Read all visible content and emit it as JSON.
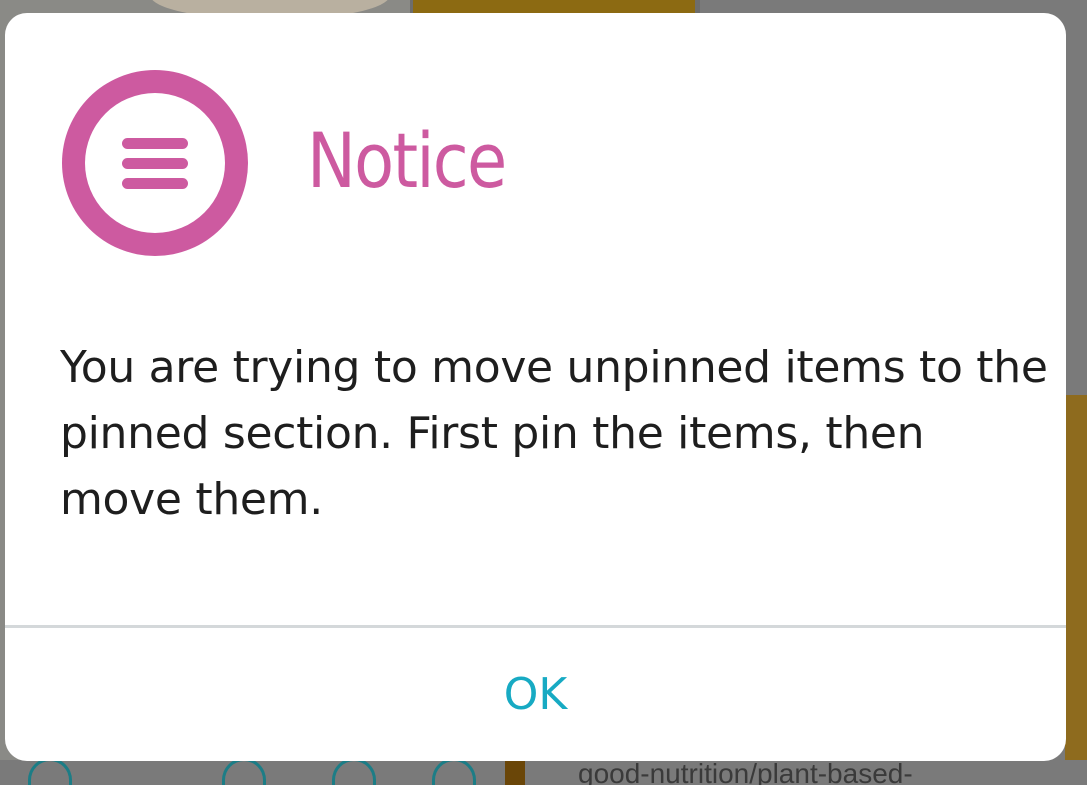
{
  "dialog": {
    "icon": "menu-icon",
    "title": "Notice",
    "message": "You are trying to move unpinned items to the pinned section. First pin the items, then move them.",
    "ok_label": "OK"
  },
  "background": {
    "url_fragment": "good-nutrition/plant-based-"
  },
  "colors": {
    "accent": "#cd5aa0",
    "button_text": "#17aac3",
    "message_text": "#1e1e1e",
    "divider": "#d4d8da"
  }
}
